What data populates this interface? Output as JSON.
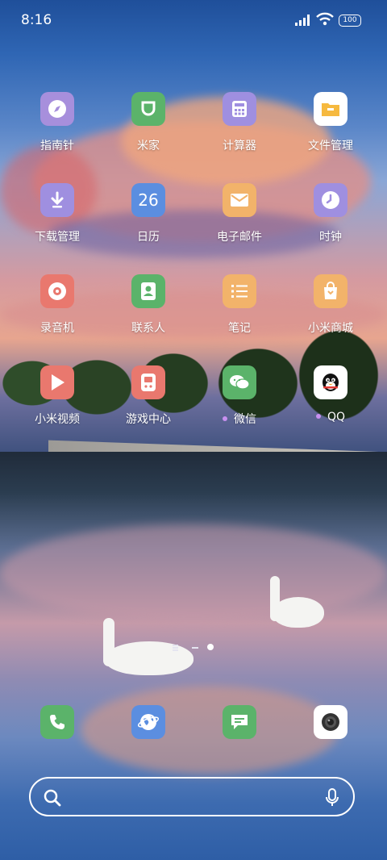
{
  "status_bar": {
    "time": "8:16",
    "battery": "100"
  },
  "apps": [
    {
      "label": "指南针",
      "icon": "compass-icon",
      "color": "#a78fdc"
    },
    {
      "label": "米家",
      "icon": "mijia-icon",
      "color": "#5bb36a"
    },
    {
      "label": "计算器",
      "icon": "calculator-icon",
      "color": "#9f8fe0"
    },
    {
      "label": "文件管理",
      "icon": "folder-icon",
      "color": "#f6b93f"
    },
    {
      "label": "下载管理",
      "icon": "download-icon",
      "color": "#9f8fe0"
    },
    {
      "label": "日历",
      "icon": "calendar-icon",
      "color": "#5b8ee0",
      "badge": "26"
    },
    {
      "label": "电子邮件",
      "icon": "mail-icon",
      "color": "#f2b36a"
    },
    {
      "label": "时钟",
      "icon": "clock-icon",
      "color": "#9f8fe0"
    },
    {
      "label": "录音机",
      "icon": "recorder-icon",
      "color": "#e9786e"
    },
    {
      "label": "联系人",
      "icon": "contacts-icon",
      "color": "#5bb36a"
    },
    {
      "label": "笔记",
      "icon": "notes-icon",
      "color": "#f2b36a"
    },
    {
      "label": "小米商城",
      "icon": "store-bag-icon",
      "color": "#f2b36a"
    },
    {
      "label": "小米视频",
      "icon": "play-icon",
      "color": "#e9786e"
    },
    {
      "label": "游戏中心",
      "icon": "gamepad-icon",
      "color": "#e9786e"
    },
    {
      "label": "微信",
      "icon": "wechat-icon",
      "color": "#5bb36a",
      "new_dot": true
    },
    {
      "label": "QQ",
      "icon": "qq-penguin-icon",
      "color": "#ffffff",
      "new_dot": true
    }
  ],
  "dock": [
    {
      "icon": "phone-icon",
      "color": "#5bb36a"
    },
    {
      "icon": "browser-globe-icon",
      "color": "#5b8ee0"
    },
    {
      "icon": "messages-icon",
      "color": "#5bb36a"
    },
    {
      "icon": "camera-icon",
      "color": "#ffffff"
    }
  ],
  "pager": {
    "pages": 2,
    "current": 2
  },
  "search": {
    "left_icon": "search-icon",
    "right_icon": "microphone-icon"
  },
  "accent_new_dot": "#c890f0"
}
